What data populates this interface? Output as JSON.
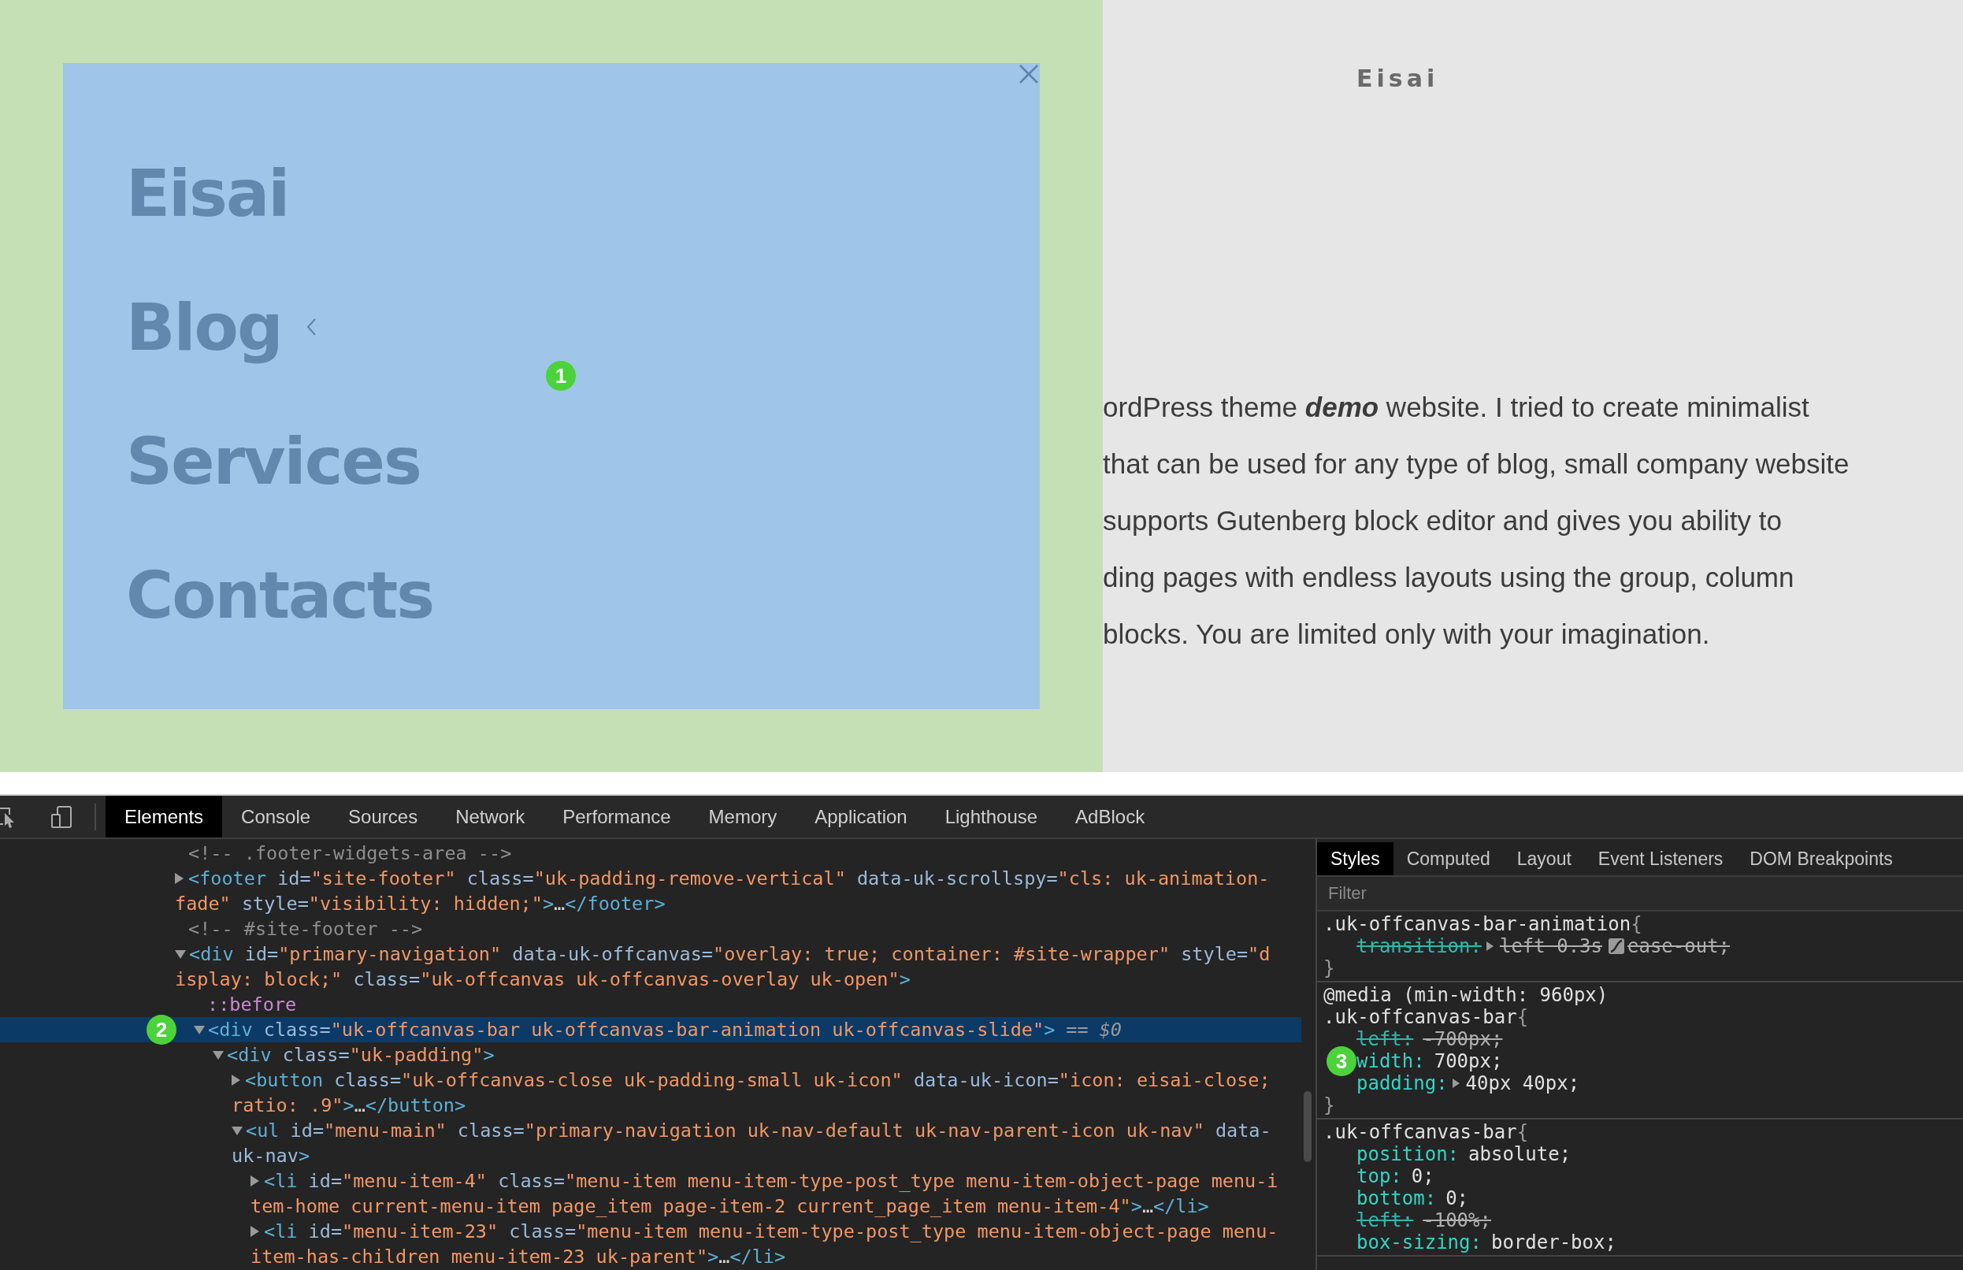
{
  "page": {
    "offcanvas": {
      "marker": "1",
      "menu_items": [
        {
          "label": "Eisai",
          "has_submenu": false
        },
        {
          "label": "Blog",
          "has_submenu": true
        },
        {
          "label": "Services",
          "has_submenu": false
        },
        {
          "label": "Contacts",
          "has_submenu": false
        }
      ]
    },
    "site_title": "Eisai",
    "paragraph_lines": [
      "ordPress theme **demo** website. I tried to create minimalist",
      "that can be used for any type of blog, small company website",
      "supports Gutenberg block editor and gives you ability to",
      "ding pages with endless layouts using the group, column",
      "blocks. You are limited only with your imagination."
    ]
  },
  "devtools": {
    "toolbar_tabs": [
      {
        "label": "Elements",
        "selected": true
      },
      {
        "label": "Console",
        "selected": false
      },
      {
        "label": "Sources",
        "selected": false
      },
      {
        "label": "Network",
        "selected": false
      },
      {
        "label": "Performance",
        "selected": false
      },
      {
        "label": "Memory",
        "selected": false
      },
      {
        "label": "Application",
        "selected": false
      },
      {
        "label": "Lighthouse",
        "selected": false
      },
      {
        "label": "AdBlock",
        "selected": false
      }
    ],
    "dom_tree": [
      {
        "selected": false,
        "lines": [
          [
            {
              "kind": "comment",
              "text": "<!-- .footer-widgets-area -->"
            }
          ]
        ]
      },
      {
        "selected": false,
        "expanded": false,
        "lines": [
          [
            {
              "kind": "tag",
              "text": "<footer"
            },
            {
              "kind": "attr",
              "text": " id="
            },
            {
              "kind": "value",
              "text": "\"site-footer\""
            },
            {
              "kind": "attr",
              "text": " class="
            },
            {
              "kind": "value",
              "text": "\"uk-padding-remove-vertical\""
            },
            {
              "kind": "attr",
              "text": " data-uk-scrollspy="
            },
            {
              "kind": "value",
              "text": "\"cls: uk-animation-"
            }
          ],
          [
            {
              "kind": "value",
              "text": "fade\""
            },
            {
              "kind": "attr",
              "text": " style="
            },
            {
              "kind": "value",
              "text": "\"visibility: hidden;\""
            },
            {
              "kind": "tag",
              "text": ">"
            },
            {
              "kind": "plain",
              "text": "…"
            },
            {
              "kind": "tag",
              "text": "</footer>"
            }
          ]
        ]
      },
      {
        "selected": false,
        "lines": [
          [
            {
              "kind": "comment",
              "text": "<!-- #site-footer -->"
            }
          ]
        ]
      },
      {
        "selected": false,
        "expanded": true,
        "lines": [
          [
            {
              "kind": "tag",
              "text": "<div"
            },
            {
              "kind": "attr",
              "text": " id="
            },
            {
              "kind": "value",
              "text": "\"primary-navigation\""
            },
            {
              "kind": "attr",
              "text": " data-uk-offcanvas="
            },
            {
              "kind": "value",
              "text": "\"overlay: true; container: #site-wrapper\""
            },
            {
              "kind": "attr",
              "text": " style="
            },
            {
              "kind": "value",
              "text": "\"d"
            }
          ],
          [
            {
              "kind": "value",
              "text": "isplay: block;\""
            },
            {
              "kind": "attr",
              "text": " class="
            },
            {
              "kind": "value",
              "text": "\"uk-offcanvas uk-offcanvas-overlay uk-open\""
            },
            {
              "kind": "tag",
              "text": ">"
            }
          ]
        ],
        "children": [
          {
            "selected": false,
            "lines": [
              [
                {
                  "kind": "pseudo",
                  "text": "::before"
                }
              ]
            ]
          },
          {
            "selected": true,
            "expanded": true,
            "marker": "2",
            "suffix": "== $0",
            "lines": [
              [
                {
                  "kind": "tag",
                  "text": "<div"
                },
                {
                  "kind": "attr",
                  "text": " class="
                },
                {
                  "kind": "value",
                  "text": "\"uk-offcanvas-bar uk-offcanvas-bar-animation uk-offcanvas-slide\""
                },
                {
                  "kind": "tag",
                  "text": ">"
                }
              ]
            ],
            "children": [
              {
                "selected": false,
                "expanded": true,
                "lines": [
                  [
                    {
                      "kind": "tag",
                      "text": "<div"
                    },
                    {
                      "kind": "attr",
                      "text": " class="
                    },
                    {
                      "kind": "value",
                      "text": "\"uk-padding\""
                    },
                    {
                      "kind": "tag",
                      "text": ">"
                    }
                  ]
                ],
                "children": [
                  {
                    "selected": false,
                    "expanded": false,
                    "lines": [
                      [
                        {
                          "kind": "tag",
                          "text": "<button"
                        },
                        {
                          "kind": "attr",
                          "text": " class="
                        },
                        {
                          "kind": "value",
                          "text": "\"uk-offcanvas-close uk-padding-small uk-icon\""
                        },
                        {
                          "kind": "attr",
                          "text": " data-uk-icon="
                        },
                        {
                          "kind": "value",
                          "text": "\"icon: eisai-close;"
                        }
                      ],
                      [
                        {
                          "kind": "value",
                          "text": "ratio: .9\""
                        },
                        {
                          "kind": "tag",
                          "text": ">"
                        },
                        {
                          "kind": "plain",
                          "text": "…"
                        },
                        {
                          "kind": "tag",
                          "text": "</button>"
                        }
                      ]
                    ]
                  },
                  {
                    "selected": false,
                    "expanded": true,
                    "lines": [
                      [
                        {
                          "kind": "tag",
                          "text": "<ul"
                        },
                        {
                          "kind": "attr",
                          "text": " id="
                        },
                        {
                          "kind": "value",
                          "text": "\"menu-main\""
                        },
                        {
                          "kind": "attr",
                          "text": " class="
                        },
                        {
                          "kind": "value",
                          "text": "\"primary-navigation uk-nav-default uk-nav-parent-icon uk-nav\""
                        },
                        {
                          "kind": "attr",
                          "text": " data-"
                        }
                      ],
                      [
                        {
                          "kind": "attr",
                          "text": "uk-nav"
                        },
                        {
                          "kind": "tag",
                          "text": ">"
                        }
                      ]
                    ],
                    "children": [
                      {
                        "selected": false,
                        "expanded": false,
                        "lines": [
                          [
                            {
                              "kind": "tag",
                              "text": "<li"
                            },
                            {
                              "kind": "attr",
                              "text": " id="
                            },
                            {
                              "kind": "value",
                              "text": "\"menu-item-4\""
                            },
                            {
                              "kind": "attr",
                              "text": " class="
                            },
                            {
                              "kind": "value",
                              "text": "\"menu-item menu-item-type-post_type menu-item-object-page menu-i"
                            }
                          ],
                          [
                            {
                              "kind": "value",
                              "text": "tem-home current-menu-item page_item page-item-2 current_page_item menu-item-4\""
                            },
                            {
                              "kind": "tag",
                              "text": ">"
                            },
                            {
                              "kind": "plain",
                              "text": "…"
                            },
                            {
                              "kind": "tag",
                              "text": "</li>"
                            }
                          ]
                        ]
                      },
                      {
                        "selected": false,
                        "expanded": false,
                        "lines": [
                          [
                            {
                              "kind": "tag",
                              "text": "<li"
                            },
                            {
                              "kind": "attr",
                              "text": " id="
                            },
                            {
                              "kind": "value",
                              "text": "\"menu-item-23\""
                            },
                            {
                              "kind": "attr",
                              "text": " class="
                            },
                            {
                              "kind": "value",
                              "text": "\"menu-item menu-item-type-post_type menu-item-object-page menu-"
                            }
                          ],
                          [
                            {
                              "kind": "value",
                              "text": "item-has-children menu-item-23 uk-parent\""
                            },
                            {
                              "kind": "tag",
                              "text": ">"
                            },
                            {
                              "kind": "plain",
                              "text": "…"
                            },
                            {
                              "kind": "tag",
                              "text": "</li>"
                            }
                          ]
                        ]
                      }
                    ]
                  }
                ]
              }
            ]
          }
        ]
      }
    ],
    "styles_tabs": [
      {
        "label": "Styles",
        "selected": true
      },
      {
        "label": "Computed",
        "selected": false
      },
      {
        "label": "Layout",
        "selected": false
      },
      {
        "label": "Event Listeners",
        "selected": false
      },
      {
        "label": "DOM Breakpoints",
        "selected": false
      }
    ],
    "filter_placeholder": "Filter",
    "rules": [
      {
        "selector": ".uk-offcanvas-bar-animation",
        "open": "{",
        "close": "}",
        "declarations": [
          {
            "property": "transition:",
            "value": "left 0.3s",
            "easing": "ease-out;",
            "struck": true,
            "expandable": true
          }
        ]
      },
      {
        "media": "@media (min-width: 960px)",
        "selector": ".uk-offcanvas-bar",
        "open": "{",
        "close": "}",
        "declarations": [
          {
            "property": "left:",
            "value": "-700px;",
            "struck": true,
            "expandable": false
          },
          {
            "property": "width:",
            "value": "700px;",
            "struck": false,
            "expandable": false,
            "marker": "3"
          },
          {
            "property": "padding:",
            "value": "40px 40px;",
            "struck": false,
            "expandable": true
          }
        ]
      },
      {
        "selector": ".uk-offcanvas-bar",
        "open": "{",
        "declarations": [
          {
            "property": "position:",
            "value": "absolute;",
            "struck": false,
            "expandable": false
          },
          {
            "property": "top:",
            "value": "0;",
            "struck": false,
            "expandable": false
          },
          {
            "property": "bottom:",
            "value": "0;",
            "struck": false,
            "expandable": false
          },
          {
            "property": "left:",
            "value": "-100%;",
            "struck": true,
            "expandable": false
          },
          {
            "property": "box-sizing:",
            "value": "border-box;",
            "struck": false,
            "expandable": false
          }
        ]
      }
    ]
  }
}
